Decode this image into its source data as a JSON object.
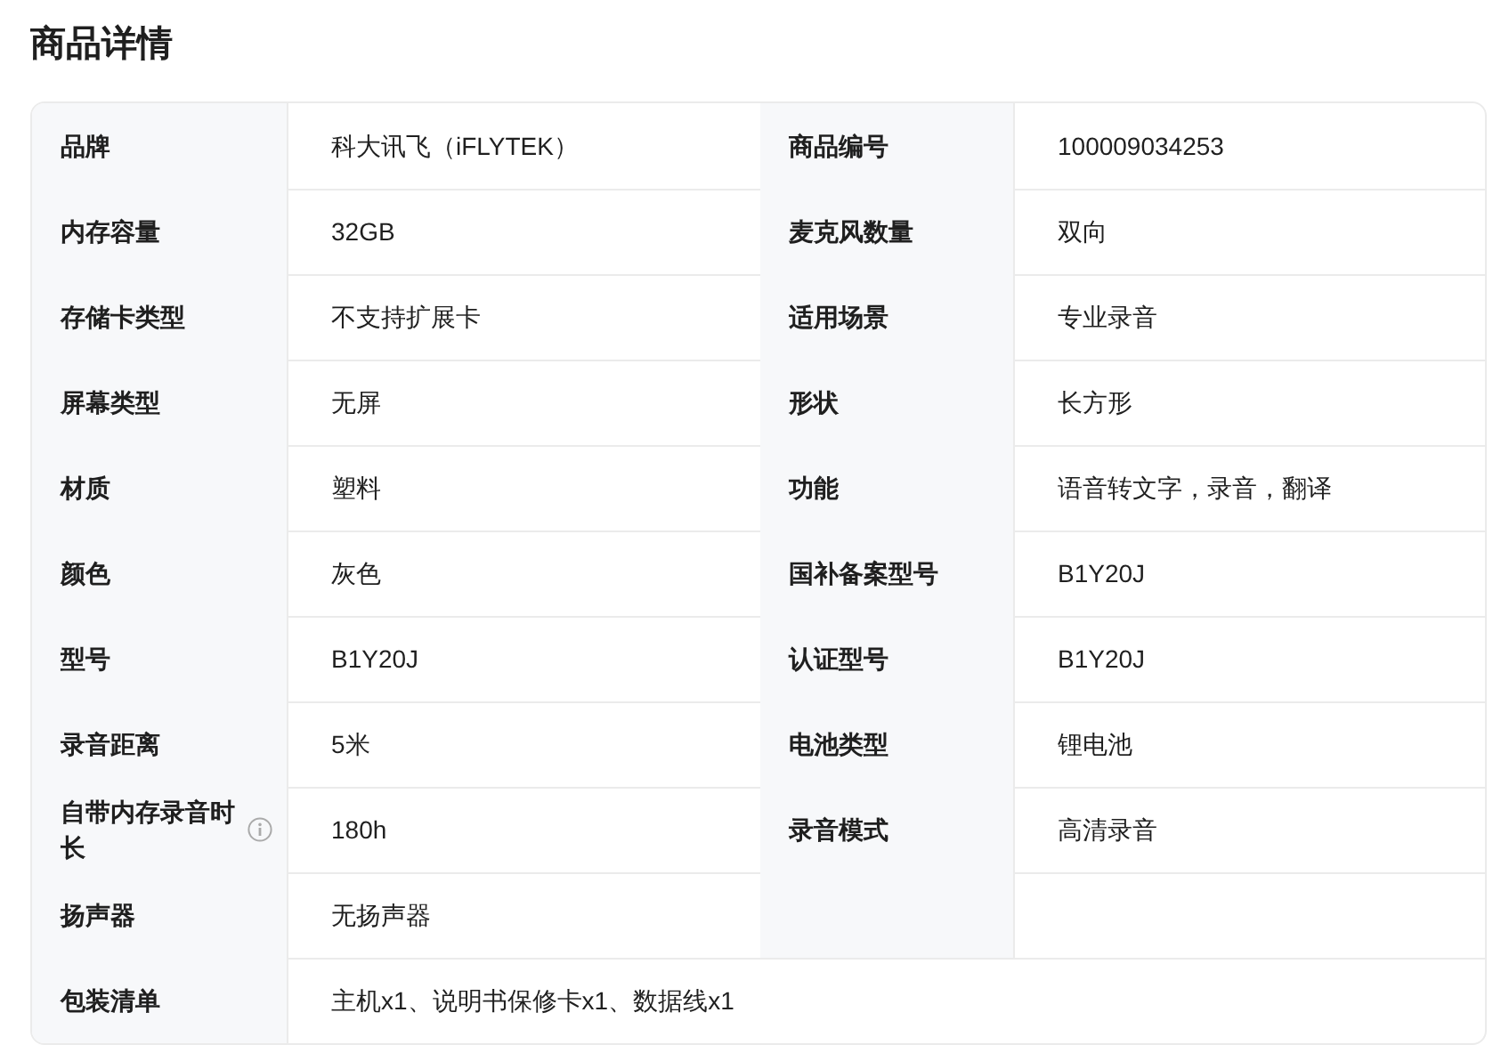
{
  "title": "商品详情",
  "rows": [
    [
      {
        "label": "品牌",
        "value": "科大讯飞（iFLYTEK）",
        "info_icon": false
      },
      {
        "label": "商品编号",
        "value": "100009034253",
        "info_icon": false
      }
    ],
    [
      {
        "label": "内存容量",
        "value": "32GB",
        "info_icon": false
      },
      {
        "label": "麦克风数量",
        "value": "双向",
        "info_icon": false
      }
    ],
    [
      {
        "label": "存储卡类型",
        "value": "不支持扩展卡",
        "info_icon": false
      },
      {
        "label": "适用场景",
        "value": "专业录音",
        "info_icon": false
      }
    ],
    [
      {
        "label": "屏幕类型",
        "value": "无屏",
        "info_icon": false
      },
      {
        "label": "形状",
        "value": "长方形",
        "info_icon": false
      }
    ],
    [
      {
        "label": "材质",
        "value": "塑料",
        "info_icon": false
      },
      {
        "label": "功能",
        "value": "语音转文字，录音，翻译",
        "info_icon": false
      }
    ],
    [
      {
        "label": "颜色",
        "value": "灰色",
        "info_icon": false
      },
      {
        "label": "国补备案型号",
        "value": "B1Y20J",
        "info_icon": false
      }
    ],
    [
      {
        "label": "型号",
        "value": "B1Y20J",
        "info_icon": false
      },
      {
        "label": "认证型号",
        "value": "B1Y20J",
        "info_icon": false
      }
    ],
    [
      {
        "label": "录音距离",
        "value": "5米",
        "info_icon": false
      },
      {
        "label": "电池类型",
        "value": "锂电池",
        "info_icon": false
      }
    ],
    [
      {
        "label": "自带内存录音时长",
        "value": "180h",
        "info_icon": true
      },
      {
        "label": "录音模式",
        "value": "高清录音",
        "info_icon": false
      }
    ],
    [
      {
        "label": "扬声器",
        "value": "无扬声器",
        "info_icon": false
      }
    ],
    [
      {
        "label": "包装清单",
        "value": "主机x1、说明书保修卡x1、数据线x1",
        "info_icon": false,
        "full_width": true
      }
    ]
  ]
}
